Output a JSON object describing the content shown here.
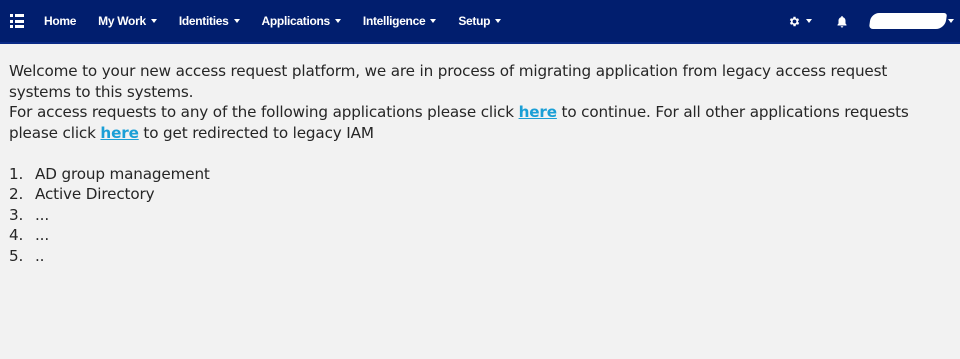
{
  "nav": {
    "items": [
      {
        "label": "Home",
        "dropdown": false
      },
      {
        "label": "My Work",
        "dropdown": true
      },
      {
        "label": "Identities",
        "dropdown": true
      },
      {
        "label": "Applications",
        "dropdown": true
      },
      {
        "label": "Intelligence",
        "dropdown": true
      },
      {
        "label": "Setup",
        "dropdown": true
      }
    ],
    "icons": {
      "menu": "hamburger-menu-icon",
      "settings": "gear-icon",
      "notifications": "bell-icon",
      "user": "redacted-username"
    },
    "colors": {
      "navbar_bg": "#011e6e",
      "link": "#1a9fd6",
      "page_bg": "#f2f2f2"
    }
  },
  "content": {
    "welcome": "Welcome to your new access request platform, we are in process of migrating application from legacy access request systems to this systems.",
    "line2_pre": "For access requests to any of the following applications please click ",
    "line2_link": "here",
    "line2_mid": " to continue. For all other applications requests please click ",
    "line2_link2": "here",
    "line2_post": " to get redirected to legacy IAM",
    "apps": [
      {
        "num": "1.",
        "label": "AD group management"
      },
      {
        "num": "2.",
        "label": "Active Directory"
      },
      {
        "num": "3.",
        "label": "..."
      },
      {
        "num": "4.",
        "label": "..."
      },
      {
        "num": "5.",
        "label": ".."
      }
    ]
  }
}
